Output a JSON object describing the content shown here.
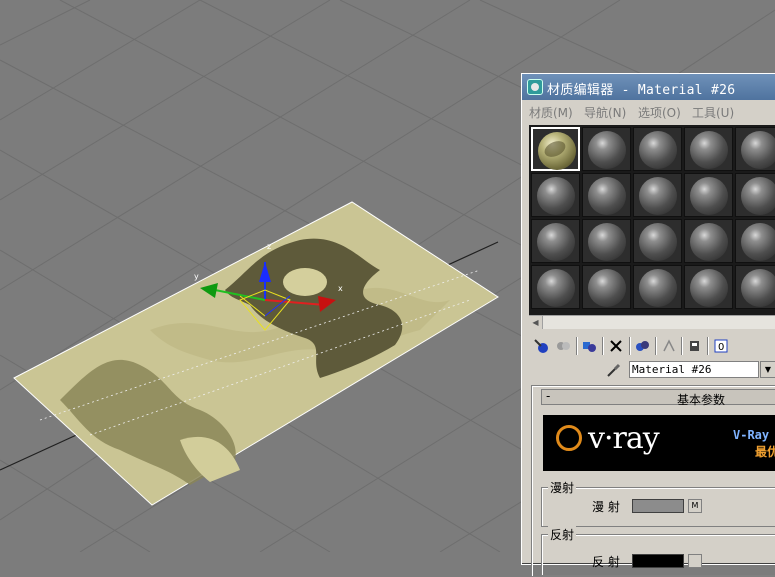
{
  "window": {
    "title": "材质编辑器 - Material #26"
  },
  "menu": [
    {
      "label": "材质(M)"
    },
    {
      "label": "导航(N)"
    },
    {
      "label": "选项(O)"
    },
    {
      "label": "工具(U)"
    }
  ],
  "gizmo": {
    "x_label": "x",
    "y_label": "y",
    "z_label": "z"
  },
  "material_name": "Material #26",
  "rollout": {
    "toggle": "-",
    "title": "基本参数"
  },
  "banner": {
    "logo": "v·ray",
    "ad_line1": "V-Ray i",
    "ad_line2": "最优"
  },
  "diffuse": {
    "group_label": "漫射",
    "field_label": "漫  射",
    "map_button": "M",
    "color": "#8c8c8c"
  },
  "reflect": {
    "group_label": "反射",
    "field_label": "反  射",
    "color": "#000000"
  }
}
